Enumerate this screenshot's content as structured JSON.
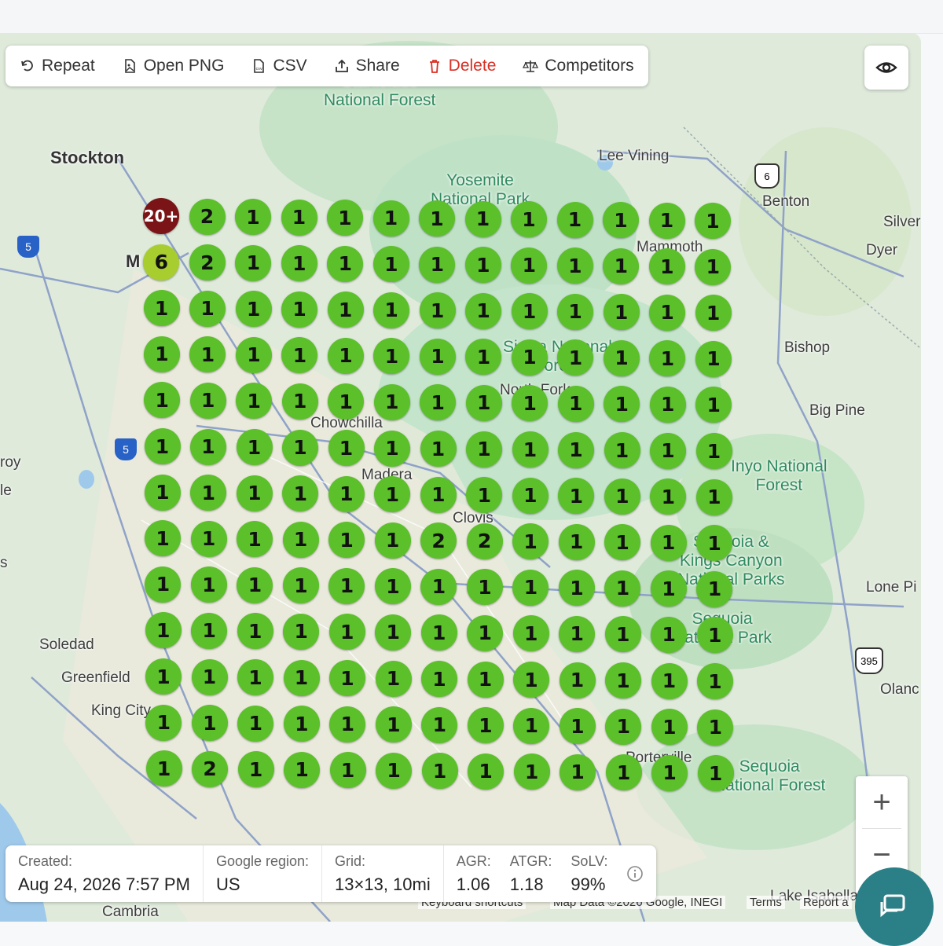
{
  "toolbar": {
    "repeat": "Repeat",
    "open_png": "Open PNG",
    "csv": "CSV",
    "share": "Share",
    "delete": "Delete",
    "competitors": "Competitors"
  },
  "map_labels": {
    "stockton": "Stockton",
    "modesto": "M     st",
    "lee_vining": "Lee Vining",
    "benton": "Benton",
    "silver": "Silver",
    "dyer": "Dyer",
    "mammoth": "Mammoth",
    "bishop": "Bishop",
    "big_pine": "Big Pine",
    "chowchilla": "Chowchilla",
    "madera": "Madera",
    "clovis": "Clovis",
    "soledad": "Soledad",
    "greenfield": "Greenfield",
    "king_city": "King City",
    "lone_pine": "Lone Pi",
    "olancha": "Olanc",
    "roy": "roy",
    "le": "le",
    "s": "s",
    "stanislaus": "Stanislaus\nNational Forest",
    "yosemite": "Yosemite\nNational Park",
    "sierra": "Sierra National\nForest",
    "north_fork": "North Fork",
    "inyo": "Inyo National\nForest",
    "kings_canyon": "Sequoia &\nKings Canyon\nNational Parks",
    "sequoia_np": "Sequoia\nNational Park",
    "sequoia_nf": "Sequoia\nNational Forest",
    "porterville": "Porterville",
    "lake_isabella": "Lake Isabella",
    "cambria": "Cambria"
  },
  "highway_shields": [
    "395",
    "6",
    "5",
    "5",
    "5",
    "5",
    "395"
  ],
  "grid": {
    "rows": [
      [
        "20+",
        "2",
        "1",
        "1",
        "1",
        "1",
        "1",
        "1",
        "1",
        "1",
        "1",
        "1",
        "1"
      ],
      [
        "6",
        "2",
        "1",
        "1",
        "1",
        "1",
        "1",
        "1",
        "1",
        "1",
        "1",
        "1",
        "1"
      ],
      [
        "1",
        "1",
        "1",
        "1",
        "1",
        "1",
        "1",
        "1",
        "1",
        "1",
        "1",
        "1",
        "1"
      ],
      [
        "1",
        "1",
        "1",
        "1",
        "1",
        "1",
        "1",
        "1",
        "1",
        "1",
        "1",
        "1",
        "1"
      ],
      [
        "1",
        "1",
        "1",
        "1",
        "1",
        "1",
        "1",
        "1",
        "1",
        "1",
        "1",
        "1",
        "1"
      ],
      [
        "1",
        "1",
        "1",
        "1",
        "1",
        "1",
        "1",
        "1",
        "1",
        "1",
        "1",
        "1",
        "1"
      ],
      [
        "1",
        "1",
        "1",
        "1",
        "1",
        "1",
        "1",
        "1",
        "1",
        "1",
        "1",
        "1",
        "1"
      ],
      [
        "1",
        "1",
        "1",
        "1",
        "1",
        "1",
        "2",
        "2",
        "1",
        "1",
        "1",
        "1",
        "1"
      ],
      [
        "1",
        "1",
        "1",
        "1",
        "1",
        "1",
        "1",
        "1",
        "1",
        "1",
        "1",
        "1",
        "1"
      ],
      [
        "1",
        "1",
        "1",
        "1",
        "1",
        "1",
        "1",
        "1",
        "1",
        "1",
        "1",
        "1",
        "1"
      ],
      [
        "1",
        "1",
        "1",
        "1",
        "1",
        "1",
        "1",
        "1",
        "1",
        "1",
        "1",
        "1",
        "1"
      ],
      [
        "1",
        "1",
        "1",
        "1",
        "1",
        "1",
        "1",
        "1",
        "1",
        "1",
        "1",
        "1",
        "1"
      ],
      [
        "1",
        "2",
        "1",
        "1",
        "1",
        "1",
        "1",
        "1",
        "1",
        "1",
        "1",
        "1",
        "1"
      ]
    ],
    "colors": {
      "top3": "#5cc02a",
      "rank6": "#a8cd2f",
      "rank20plus": "#7a1416"
    }
  },
  "info": {
    "created_label": "Created:",
    "created_value": "Aug 24, 2026 7:57 PM",
    "region_label": "Google region:",
    "region_value": "US",
    "grid_label": "Grid:",
    "grid_value": "13×13, 10mi",
    "agr_label": "AGR:",
    "agr_value": "1.06",
    "atgr_label": "ATGR:",
    "atgr_value": "1.18",
    "solv_label": "SoLV:",
    "solv_value": "99%"
  },
  "attribution": {
    "shortcuts": "Keyboard shortcuts",
    "mapdata": "Map Data ©2026 Google, INEGI",
    "terms": "Terms",
    "report": "Report a"
  },
  "zoom": {
    "in": "+",
    "out": "−"
  }
}
